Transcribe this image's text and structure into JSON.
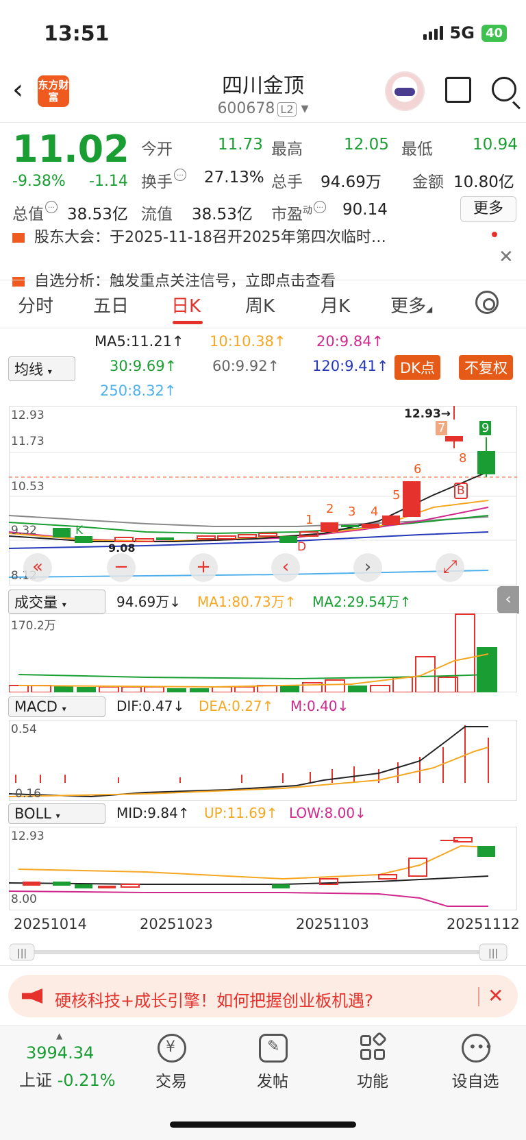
{
  "status": {
    "time": "13:51",
    "network": "5G",
    "battery": "40"
  },
  "header": {
    "logo": "东方财富",
    "name": "四川金顶",
    "code": "600678",
    "level": "L2"
  },
  "quote": {
    "price": "11.02",
    "pct": "-9.38%",
    "change": "-1.14",
    "open_label": "今开",
    "open": "11.73",
    "high_label": "最高",
    "high": "12.05",
    "low_label": "最低",
    "low": "10.94",
    "turnover_label": "换手",
    "turnover": "27.13%",
    "volume_label": "总手",
    "volume": "94.69万",
    "amount_label": "金额",
    "amount": "10.80亿",
    "mktcap_label": "总值",
    "mktcap": "38.53亿",
    "float_label": "流值",
    "float": "38.53亿",
    "pe_label": "市盈",
    "pe_sup": "动",
    "pe": "90.14",
    "more": "更多"
  },
  "notices": {
    "first": "股东大会：于2025-11-18召开2025年第四次临时…",
    "second": "自选分析：触发重点关注信号，立即点击查看"
  },
  "tabs": [
    "分时",
    "五日",
    "日K",
    "周K",
    "月K",
    "更多"
  ],
  "ma_legend": {
    "select": "均线",
    "ma5": "MA5:11.21↑",
    "ma10": "10:10.38↑",
    "ma20": "20:9.84↑",
    "ma30": "30:9.69↑",
    "ma60": "60:9.92↑",
    "ma120": "120:9.41↑",
    "ma250": "250:8.32↑",
    "dk": "DK点",
    "fq": "不复权"
  },
  "kline": {
    "y_labels": [
      "12.93",
      "11.73",
      "10.53",
      "9.32",
      "8.12"
    ],
    "high_note": "12.93→",
    "low_note": "9.08",
    "markers": [
      "1",
      "2",
      "3",
      "4",
      "5",
      "6",
      "7",
      "8",
      "9"
    ],
    "letter_b": "B",
    "letter_d": "D",
    "letter_k": "K"
  },
  "volume": {
    "select": "成交量",
    "value": "94.69万↓",
    "ma1": "MA1:80.73万↑",
    "ma2": "MA2:29.54万↑",
    "y_label": "170.2万"
  },
  "macd": {
    "select": "MACD",
    "dif": "DIF:0.47↓",
    "dea": "DEA:0.27↑",
    "m": "M:0.40↓",
    "y_top": "0.54",
    "y_bottom": "-0.16"
  },
  "boll": {
    "select": "BOLL",
    "mid": "MID:9.84↑",
    "up": "UP:11.69↑",
    "low": "LOW:8.00↓",
    "y_top": "12.93",
    "y_bottom": "8.00"
  },
  "dates": [
    "20251014",
    "20251023",
    "20251103",
    "20251112"
  ],
  "banner": {
    "text": "硬核科技+成长引擎！如何把握创业板机遇?"
  },
  "bottom_bar": {
    "index_value": "3994.34",
    "index_label": "上证",
    "index_pct": "-0.21%",
    "items": [
      "交易",
      "发帖",
      "功能",
      "设自选"
    ]
  },
  "colors": {
    "up": "#e5322d",
    "down": "#1a9e33",
    "accent": "#ef5a1e"
  }
}
